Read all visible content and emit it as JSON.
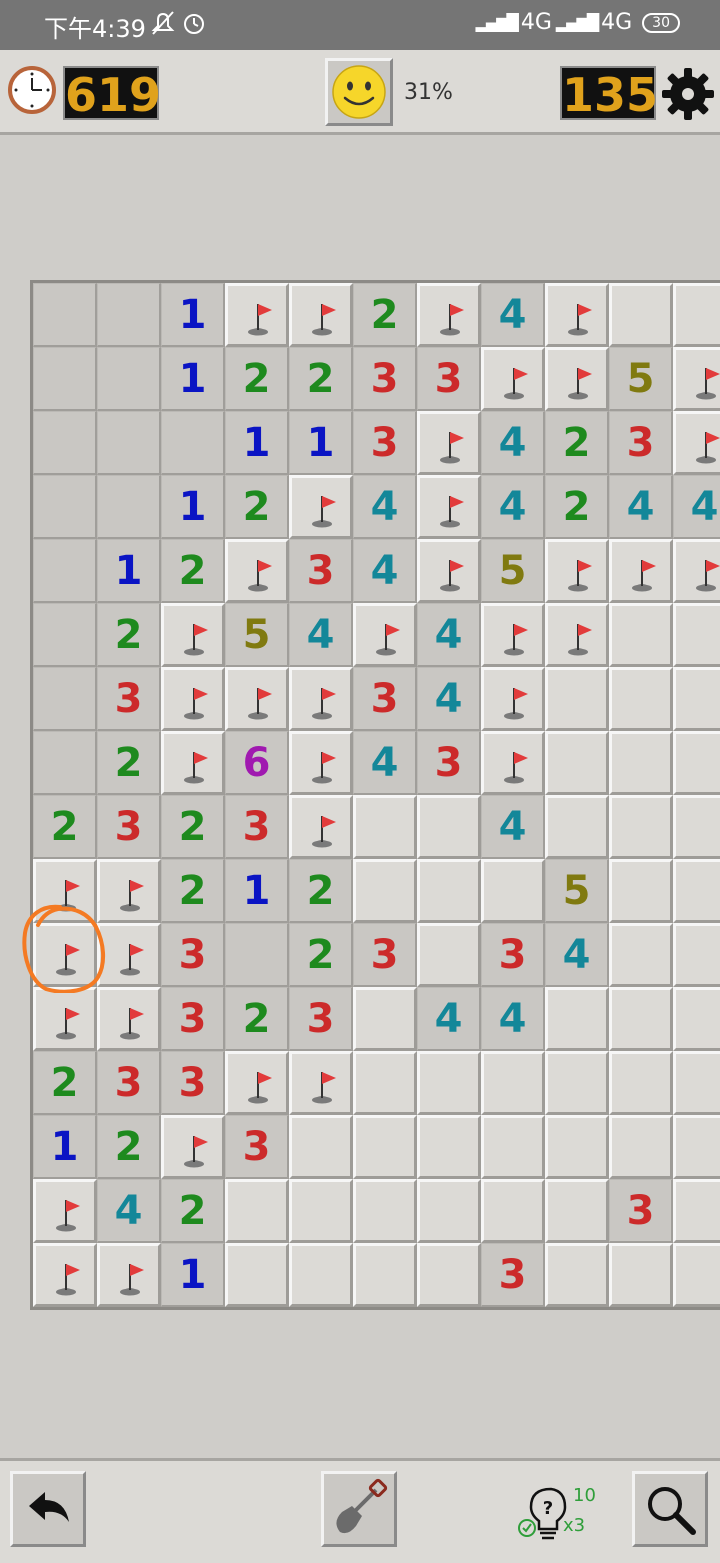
{
  "status_bar": {
    "time": "下午4:39",
    "network_1": "4G",
    "network_2": "4G",
    "battery": "30"
  },
  "top_bar": {
    "timer": "619",
    "progress": "31%",
    "mines_remaining": "135"
  },
  "board": {
    "rows": [
      [
        "o",
        "o",
        "1",
        "F",
        "F",
        "2",
        "F",
        "4",
        "F",
        "c",
        "c"
      ],
      [
        "o",
        "o",
        "1",
        "2",
        "2",
        "3",
        "3",
        "F",
        "F",
        "5",
        "F"
      ],
      [
        "o",
        "o",
        "o",
        "1",
        "1",
        "3",
        "F",
        "4",
        "2",
        "3",
        "F"
      ],
      [
        "o",
        "o",
        "1",
        "2",
        "F",
        "4",
        "F",
        "4",
        "2",
        "4",
        "4"
      ],
      [
        "o",
        "1",
        "2",
        "F",
        "3",
        "4",
        "F",
        "5",
        "F",
        "F",
        "F"
      ],
      [
        "o",
        "2",
        "F",
        "5",
        "4",
        "F",
        "4",
        "F",
        "F",
        "c",
        "c"
      ],
      [
        "o",
        "3",
        "F",
        "F",
        "F",
        "3",
        "4",
        "F",
        "c",
        "c",
        "c"
      ],
      [
        "o",
        "2",
        "F",
        "6",
        "F",
        "4",
        "3",
        "F",
        "c",
        "c",
        "c"
      ],
      [
        "2",
        "3",
        "2",
        "3",
        "F",
        "c",
        "c",
        "4",
        "c",
        "c",
        "c"
      ],
      [
        "F",
        "F",
        "2",
        "1",
        "2",
        "c",
        "c",
        "c",
        "5",
        "c",
        "c"
      ],
      [
        "F",
        "F",
        "3",
        "o",
        "2",
        "3",
        "c",
        "3",
        "4",
        "c",
        "c"
      ],
      [
        "F",
        "F",
        "3",
        "2",
        "3",
        "c",
        "4",
        "4",
        "c",
        "c",
        "c"
      ],
      [
        "2",
        "3",
        "3",
        "F",
        "F",
        "c",
        "c",
        "c",
        "c",
        "c",
        "c"
      ],
      [
        "1",
        "2",
        "F",
        "3",
        "c",
        "c",
        "c",
        "c",
        "c",
        "c",
        "c"
      ],
      [
        "F",
        "4",
        "2",
        "c",
        "c",
        "c",
        "c",
        "c",
        "c",
        "3",
        "c"
      ],
      [
        "F",
        "F",
        "1",
        "c",
        "c",
        "c",
        "c",
        "3",
        "c",
        "c",
        "c"
      ]
    ],
    "number_colors": {
      "1": "#0a14c4",
      "2": "#1e8a1e",
      "3": "#cc2a2a",
      "4": "#138799",
      "5": "#807a10",
      "6": "#a019b0"
    }
  },
  "bottom_bar": {
    "hint_count": "10",
    "hint_multiplier": "x3"
  }
}
